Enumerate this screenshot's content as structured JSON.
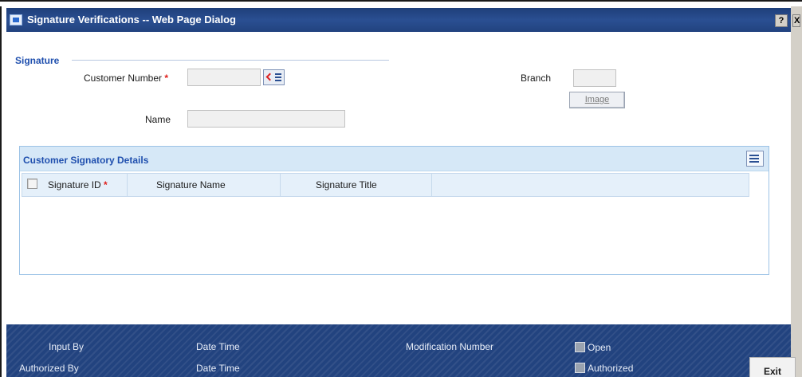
{
  "window": {
    "title": "Signature Verifications -- Web Page Dialog",
    "help_label": "?",
    "close_label": "X"
  },
  "signature_section": {
    "legend": "Signature",
    "customer_number": {
      "label": "Customer Number",
      "required_mark": "*",
      "value": ""
    },
    "name": {
      "label": "Name",
      "value": ""
    },
    "branch": {
      "label": "Branch",
      "value": ""
    },
    "image_button_label": "Image"
  },
  "signatory_details": {
    "title": "Customer Signatory Details",
    "columns": [
      {
        "label": "Signature ID",
        "required_mark": "*"
      },
      {
        "label": "Signature Name"
      },
      {
        "label": "Signature Title"
      }
    ],
    "rows": []
  },
  "footer": {
    "input_by_label": "Input By",
    "authorized_by_label": "Authorized By",
    "date_time_label_1": "Date Time",
    "date_time_label_2": "Date Time",
    "modification_number_label": "Modification Number",
    "open_label": "Open",
    "authorized_label": "Authorized",
    "exit_label": "Exit"
  },
  "colors": {
    "title_bar": "#22437f",
    "accent_text": "#1f4fae",
    "required": "#e0201c",
    "panel_header": "#d6e8f7"
  }
}
